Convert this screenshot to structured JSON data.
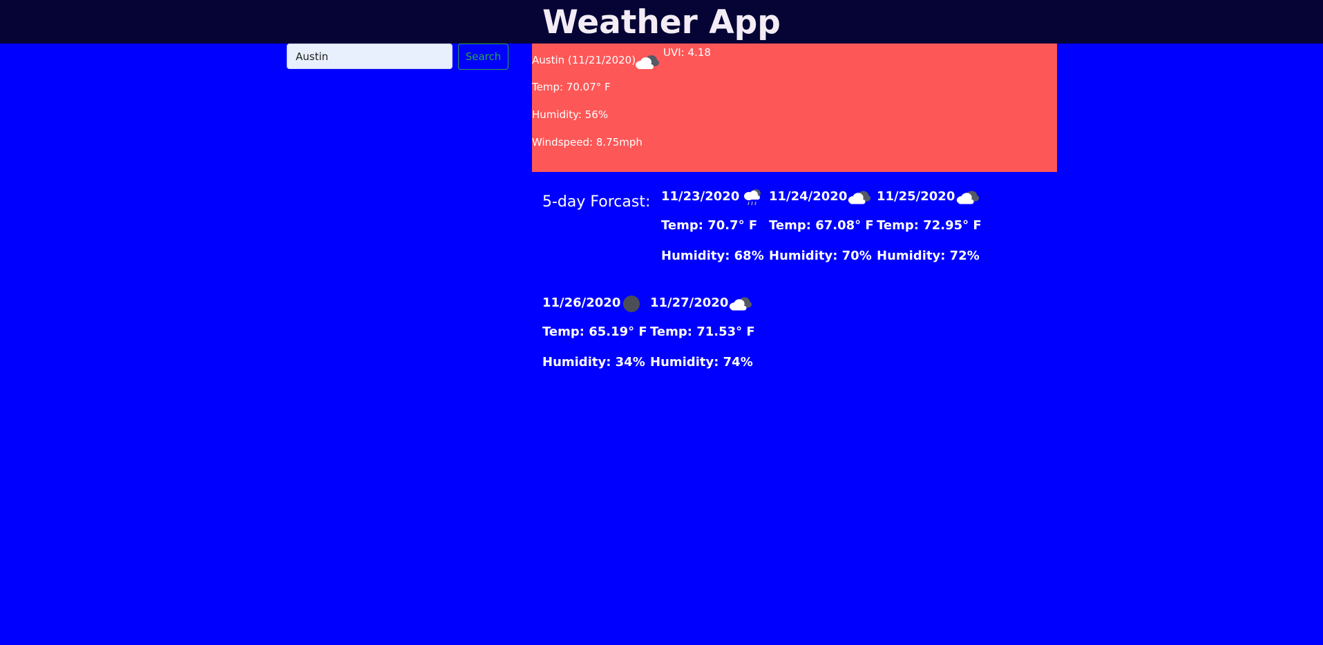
{
  "header": {
    "title": "Weather App"
  },
  "search": {
    "value": "Austin",
    "button_label": "Search"
  },
  "current": {
    "city_date": "Austin (11/21/2020)",
    "icon": "cloud-icon",
    "uvi": "UVI: 4.18",
    "temp": "Temp: 70.07° F",
    "humidity": "Humidity: 56%",
    "windspeed": "Windspeed: 8.75mph"
  },
  "forecast": {
    "label": "5-day Forcast:",
    "days": [
      {
        "date": "11/23/2020",
        "icon": "cloud-rain-icon",
        "temp": "Temp: 70.7° F",
        "humidity": "Humidity: 68%"
      },
      {
        "date": "11/24/2020",
        "icon": "cloud-icon",
        "temp": "Temp: 67.08° F",
        "humidity": "Humidity: 70%"
      },
      {
        "date": "11/25/2020",
        "icon": "cloud-icon",
        "temp": "Temp: 72.95° F",
        "humidity": "Humidity: 72%"
      },
      {
        "date": "11/26/2020",
        "icon": "dark-circle-icon",
        "temp": "Temp: 65.19° F",
        "humidity": "Humidity: 34%"
      },
      {
        "date": "11/27/2020",
        "icon": "cloud-icon",
        "temp": "Temp: 71.53° F",
        "humidity": "Humidity: 74%"
      }
    ]
  },
  "colors": {
    "page_bg": "#0000ff",
    "header_bg": "#060434",
    "current_bg": "#fe5757",
    "search_button": "#28a745"
  }
}
